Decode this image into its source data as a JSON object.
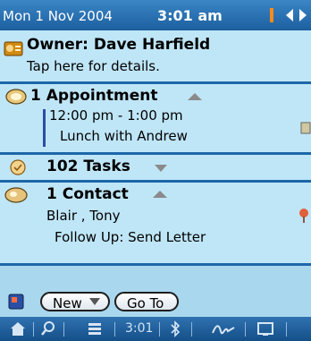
{
  "header": {
    "date": "Mon 1 Nov 2004",
    "time": "3:01 am"
  },
  "owner": {
    "title": "Owner: Dave Harfield",
    "subtitle": "Tap here for details."
  },
  "appointments": {
    "title": "1 Appointment",
    "time_range": "12:00 pm - 1:00 pm",
    "description": "Lunch with Andrew"
  },
  "tasks": {
    "title": "102 Tasks"
  },
  "contacts": {
    "title": "1 Contact",
    "name": "Blair , Tony",
    "followup": "Follow Up: Send Letter"
  },
  "buttons": {
    "new_label": "New",
    "goto_label": "Go To"
  },
  "statusbar": {
    "time": "3:01"
  },
  "colors": {
    "header": "#1c5f9f",
    "background": "#a9d7ee",
    "section": "#bfe6f7",
    "divider": "#1d67a8"
  }
}
